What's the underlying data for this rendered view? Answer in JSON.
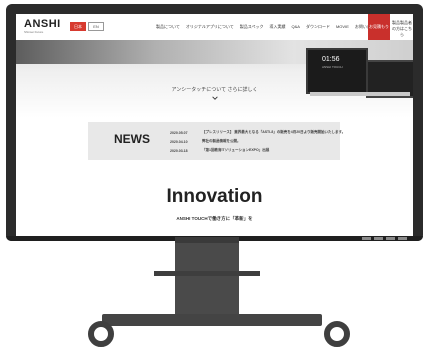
{
  "header": {
    "logo": "ANSHI",
    "logo_sub": "Shinsei Future",
    "lang_ja": "日本",
    "lang_en": "EN",
    "nav": [
      "製品について",
      "オリジナルアプリについて",
      "製品スペック",
      "導入実績",
      "Q&A",
      "ダウンロード",
      "MOVIE",
      "お問い合わせ"
    ],
    "red_button": "お見積もり",
    "cta": "製品製品者の方はこちら"
  },
  "hero": {
    "prompt": "アンシータッチについて さらに詳しく",
    "device_clock": "01:56",
    "device_sub": "ANSHI TOUCH"
  },
  "news": {
    "title": "NEWS",
    "items": [
      {
        "date": "2020.05.07",
        "text": "【プレスリリース】 業界最大となる「ASTI-8」の販売を4月20日より販売開始いたします。"
      },
      {
        "date": "2020.04.10",
        "text": "弊社の製品情報を公開。"
      },
      {
        "date": "2020.03.18",
        "text": "「第1回教育ITソリューションEXPO」出展"
      }
    ]
  },
  "innovation": {
    "title": "Innovation",
    "tagline": "ANSHI TOUCHで働き方に「革新」を"
  }
}
